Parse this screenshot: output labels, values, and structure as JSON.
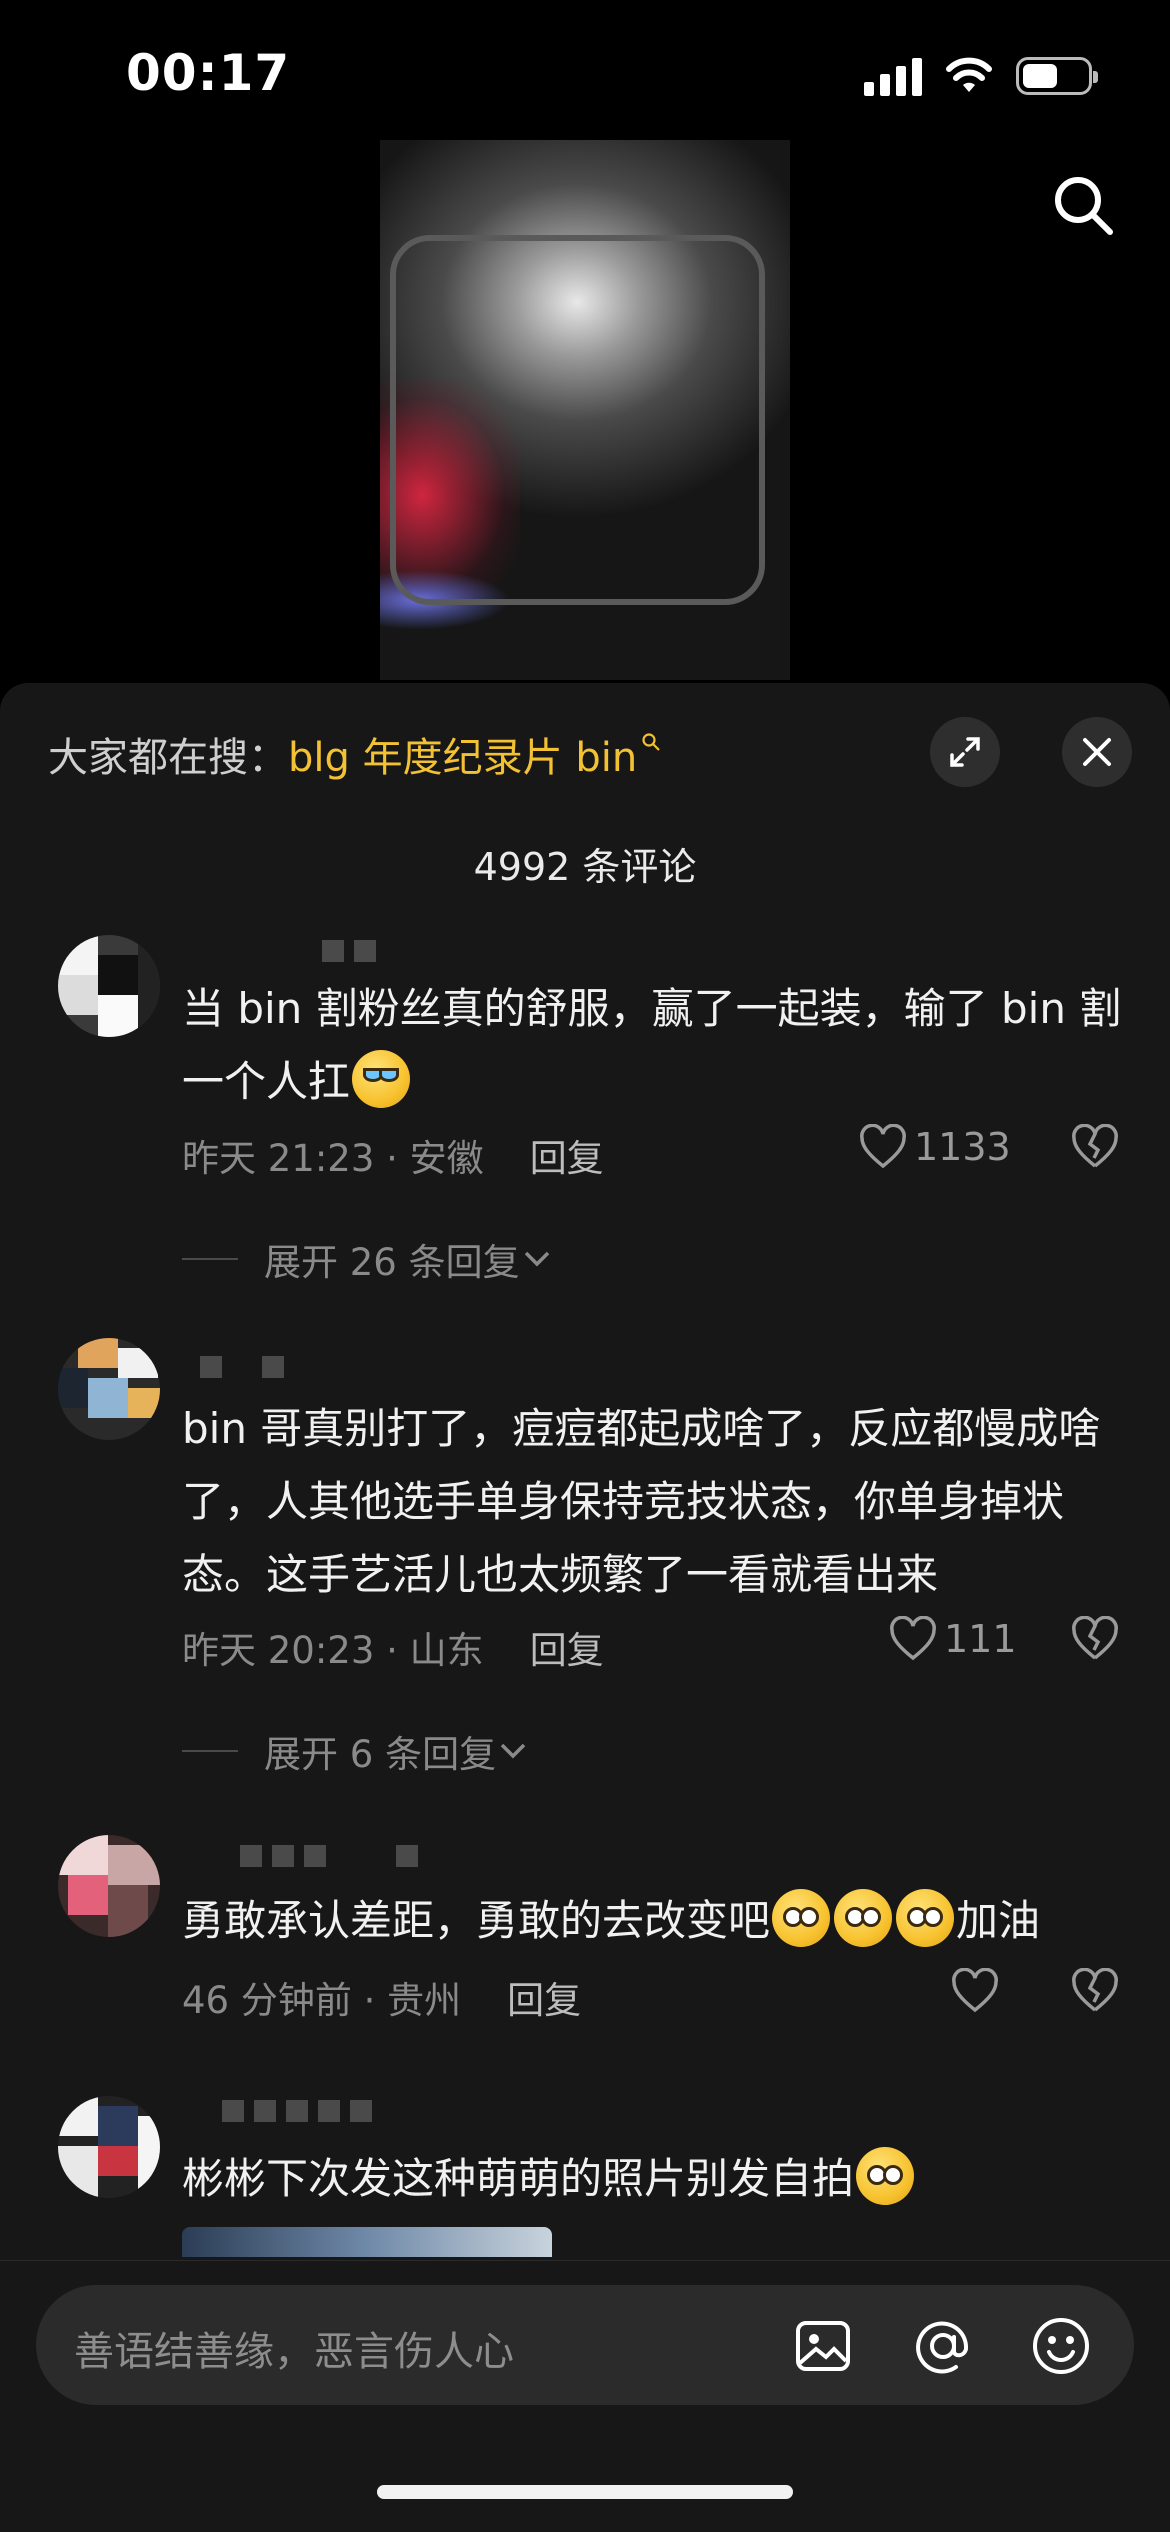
{
  "status_bar": {
    "time": "00:17",
    "battery_level": 0.55
  },
  "panel": {
    "hot_search_prefix": "大家都在搜：",
    "hot_search_keyword": "blg 年度纪录片 bin",
    "comment_count": "4992 条评论"
  },
  "comments": [
    {
      "text": "当 bin 割粉丝真的舒服，赢了一起装，输了 bin 割一个人扛",
      "time_location": "昨天 21:23 · 安徽",
      "reply_label": "回复",
      "likes": "1133",
      "expand_label": "展开 26 条回复"
    },
    {
      "text": "bin 哥真别打了，痘痘都起成啥了，反应都慢成啥了，人其他选手单身保持竞技状态，你单身掉状态。这手艺活儿也太频繁了一看就看出来",
      "time_location": "昨天 20:23 · 山东",
      "reply_label": "回复",
      "likes": "111",
      "expand_label": "展开 6 条回复"
    },
    {
      "text": "勇敢承认差距，勇敢的去改变吧",
      "text_suffix": "加油",
      "time_location": "46 分钟前 · 贵州",
      "reply_label": "回复",
      "likes": ""
    },
    {
      "text": "彬彬下次发这种萌萌的照片别发自拍"
    }
  ],
  "input": {
    "placeholder": "善语结善缘，恶言伤人心"
  },
  "icons": {
    "search": "search-icon",
    "expand": "expand-icon",
    "close": "close-icon",
    "like": "heart-icon",
    "dislike": "broken-heart-icon",
    "image": "image-icon",
    "mention": "at-icon",
    "emoji": "emoji-icon"
  },
  "colors": {
    "keyword": "#f2c134",
    "panel_bg": "#171717"
  }
}
